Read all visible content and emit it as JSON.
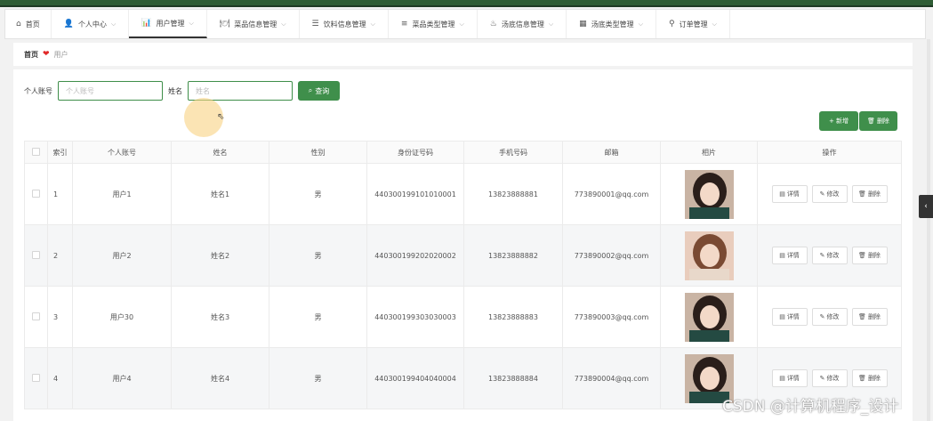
{
  "nav": {
    "items": [
      {
        "label": "首页",
        "icon": "home-icon"
      },
      {
        "label": "个人中心",
        "icon": "user-icon"
      },
      {
        "label": "用户管理",
        "icon": "chart-icon",
        "active": true
      },
      {
        "label": "菜品信息管理",
        "icon": "dish-icon"
      },
      {
        "label": "饮料信息管理",
        "icon": "sliders-icon"
      },
      {
        "label": "菜品类型管理",
        "icon": "list-icon"
      },
      {
        "label": "汤底信息管理",
        "icon": "pot-icon"
      },
      {
        "label": "汤底类型管理",
        "icon": "grid-icon"
      },
      {
        "label": "订单管理",
        "icon": "person-icon"
      }
    ]
  },
  "breadcrumb": {
    "home": "首页",
    "current": "用户"
  },
  "search": {
    "account_label": "个人账号",
    "account_placeholder": "个人账号",
    "name_label": "姓名",
    "name_placeholder": "姓名",
    "query_label": "查询"
  },
  "toolbar": {
    "add_label": "+ 新增",
    "delete_label": "删除"
  },
  "table": {
    "headers": [
      "索引",
      "个人账号",
      "姓名",
      "性别",
      "身份证号码",
      "手机号码",
      "邮箱",
      "相片",
      "操作"
    ],
    "rows": [
      {
        "index": "1",
        "account": "用户1",
        "name": "姓名1",
        "gender": "男",
        "id_card": "440300199101010001",
        "phone": "13823888881",
        "email": "773890001@qq.com",
        "photo": "dark"
      },
      {
        "index": "2",
        "account": "用户2",
        "name": "姓名2",
        "gender": "男",
        "id_card": "440300199202020002",
        "phone": "13823888882",
        "email": "773890002@qq.com",
        "photo": "light"
      },
      {
        "index": "3",
        "account": "用户30",
        "name": "姓名3",
        "gender": "男",
        "id_card": "440300199303030003",
        "phone": "13823888883",
        "email": "773890003@qq.com",
        "photo": "dark"
      },
      {
        "index": "4",
        "account": "用户4",
        "name": "姓名4",
        "gender": "男",
        "id_card": "440300199404040004",
        "phone": "13823888884",
        "email": "773890004@qq.com",
        "photo": "dark"
      }
    ],
    "row_actions": {
      "detail": "详情",
      "edit": "修改",
      "delete": "删除"
    }
  },
  "watermark": "CSDN @计算机程序_设计",
  "colors": {
    "primary": "#3f8f4b",
    "topbar": "#2f5d35"
  }
}
